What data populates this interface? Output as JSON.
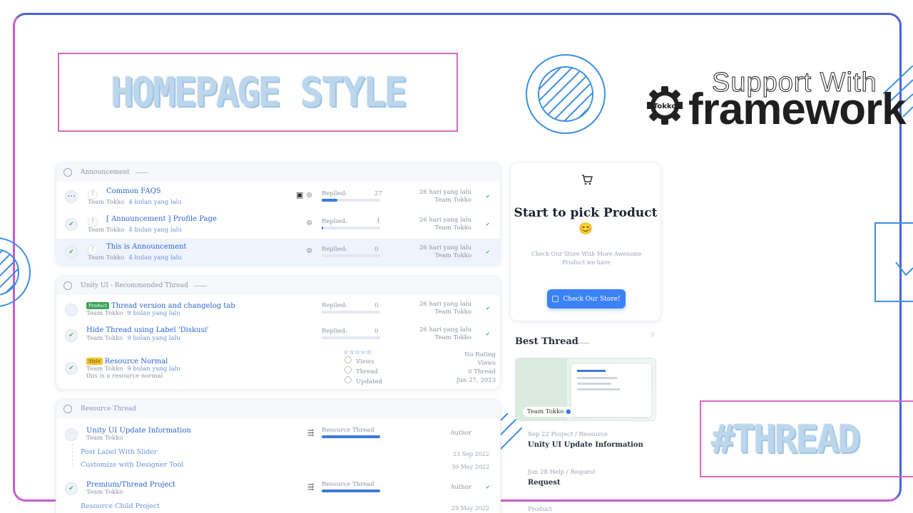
{
  "hero": {
    "title": "HOMEPAGE STYLE"
  },
  "brand": {
    "support": "Support With",
    "framework": "framework",
    "gear_label": "Tokko"
  },
  "tag": {
    "label": "#THREAD"
  },
  "announcement": {
    "header": "Announcement",
    "rows": [
      {
        "title": "Common FAQS",
        "author": "Team Tokko",
        "time": "4 bulan yang lalu",
        "replied_label": "Replied:",
        "replied": "27",
        "progress": 0.27,
        "ago": "26 hari yang lalu",
        "by": "Team Tokko"
      },
      {
        "title": "[ Announcement ] Profile Page",
        "author": "Team Tokko",
        "time": "4 bulan yang lalu",
        "replied_label": "Replied:",
        "replied": "1",
        "progress": 0.02,
        "ago": "26 hari yang lalu",
        "by": "Team Tokko"
      },
      {
        "title": "This is Announcement",
        "author": "Team Tokko",
        "time": "4 bulan yang lalu",
        "replied_label": "Replied:",
        "replied": "0",
        "progress": 0,
        "ago": "26 hari yang lalu",
        "by": "Team Tokko"
      }
    ]
  },
  "recommended": {
    "header": "Unity UI - Recommended Thread",
    "rows": [
      {
        "badge": "Product",
        "title": "Thread version and changelog tab",
        "author": "Team Tokko",
        "time": "9 bulan yang lalu",
        "replied_label": "Replied:",
        "replied": "0",
        "ago": "26 hari yang lalu",
        "by": "Team Tokko"
      },
      {
        "title": "Hide Thread using Label 'Diskusi'",
        "author": "Team Tokko",
        "time": "9 bulan yang lalu",
        "replied_label": "Replied:",
        "replied": "0",
        "ago": "26 hari yang lalu",
        "by": "Team Tokko"
      },
      {
        "badge": "Style",
        "title": "Resource Normal",
        "author": "Team Tokko",
        "time": "9 bulan yang lalu",
        "desc": "this is a resource normal",
        "stars": "☆☆☆☆☆",
        "views_label": "Views",
        "thread_label": "Thread",
        "updated_label": "Updated",
        "rating": "No Rating",
        "views": "Views",
        "threads": "0 Thread",
        "date": "Jun 27, 2023"
      }
    ]
  },
  "resource": {
    "header": "Resource Thread",
    "rows": [
      {
        "title": "Unity UI Update Information",
        "author": "Team Tokko",
        "label": "Resource Thread",
        "by": "Author",
        "progress": 1
      },
      {
        "title": "Premium/Thread Project",
        "author": "Team Tokko",
        "label": "Resource Thread",
        "by": "Author",
        "progress": 1
      }
    ],
    "children": [
      {
        "title": "Post Label With Slider",
        "date": "23 Sep 2022"
      },
      {
        "title": "Customize with Designer Tool",
        "date": "30 May 2022"
      },
      {
        "title": "Resource Child Project",
        "date": "29 May 2022"
      }
    ]
  },
  "pick": {
    "title": "Start to pick Product",
    "emoji": "😊",
    "subtitle": "Check Our Store With More Awesome Product we have",
    "button": "Check Our Store!"
  },
  "best": {
    "title": "Best Thread",
    "thumb_author": "Team Tokko",
    "items": [
      {
        "meta": "Sep 22 Project / Resource",
        "title": "Unity UI Update Information"
      },
      {
        "meta": "Jun 28 Help / Request",
        "title": "Request"
      },
      {
        "meta": "Product",
        "title": ""
      }
    ]
  },
  "colors": {
    "accent": "#3b78de",
    "frame_top": "#4a63d8",
    "frame_bottom": "#c85bd0",
    "pink_border": "#d667c8",
    "deco_blue": "#3d8fe0"
  }
}
